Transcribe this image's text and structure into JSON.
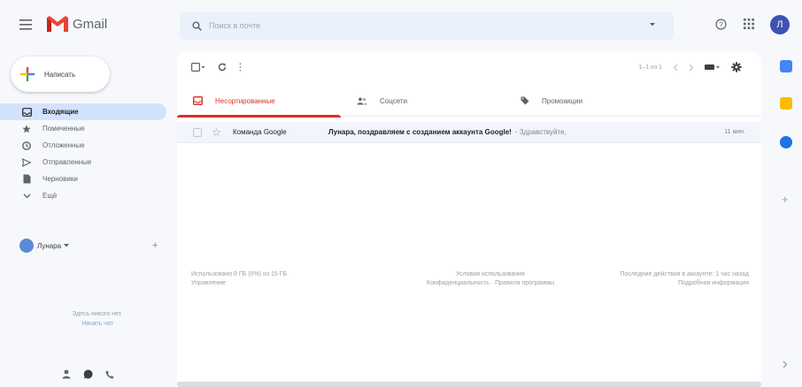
{
  "header": {
    "logo_text": "Gmail",
    "search_placeholder": "Поиск в почте",
    "avatar_letter": "Л"
  },
  "sidebar": {
    "compose_label": "Написать",
    "items": [
      {
        "label": "Входящие",
        "icon": "inbox-icon",
        "active": true
      },
      {
        "label": "Помеченные",
        "icon": "star-icon"
      },
      {
        "label": "Отложенные",
        "icon": "clock-icon"
      },
      {
        "label": "Отправленные",
        "icon": "send-icon"
      },
      {
        "label": "Черновики",
        "icon": "draft-icon"
      },
      {
        "label": "Ещё",
        "icon": "chevron-down-icon"
      }
    ],
    "hangouts_user": "Лунара",
    "hangouts_empty_line1": "Здесь никого нет.",
    "hangouts_empty_link": "Начать чат"
  },
  "toolbar": {
    "pagination": "1–1 из 1"
  },
  "tabs": [
    {
      "label": "Несортированные",
      "icon": "inbox-tab-icon",
      "active": true
    },
    {
      "label": "Соцсети",
      "icon": "people-icon"
    },
    {
      "label": "Промоакции",
      "icon": "tag-icon"
    }
  ],
  "mail": [
    {
      "sender": "Команда Google",
      "subject": "Лунара, поздравляем с созданием аккаунта Google!",
      "snippet": " - Здравствуйте,",
      "time": "11 мин."
    }
  ],
  "footer": {
    "left_line1": "Использовано 0 ГБ (0%) из 15 ГБ",
    "left_line2": "Управление",
    "mid_line1": "Условия использования",
    "mid_line2": "Конфиденциальность · Правила программы",
    "right_line1": "Последние действия в аккаунте: 1 час назад",
    "right_line2": "Подробная информация"
  },
  "colors": {
    "accent_red": "#d93025",
    "active_nav_bg": "#d3e3fd",
    "avatar_bg": "#3f51b5",
    "side_calendar": "#4285f4",
    "side_keep": "#fbbc04",
    "side_tasks": "#1a73e8"
  }
}
